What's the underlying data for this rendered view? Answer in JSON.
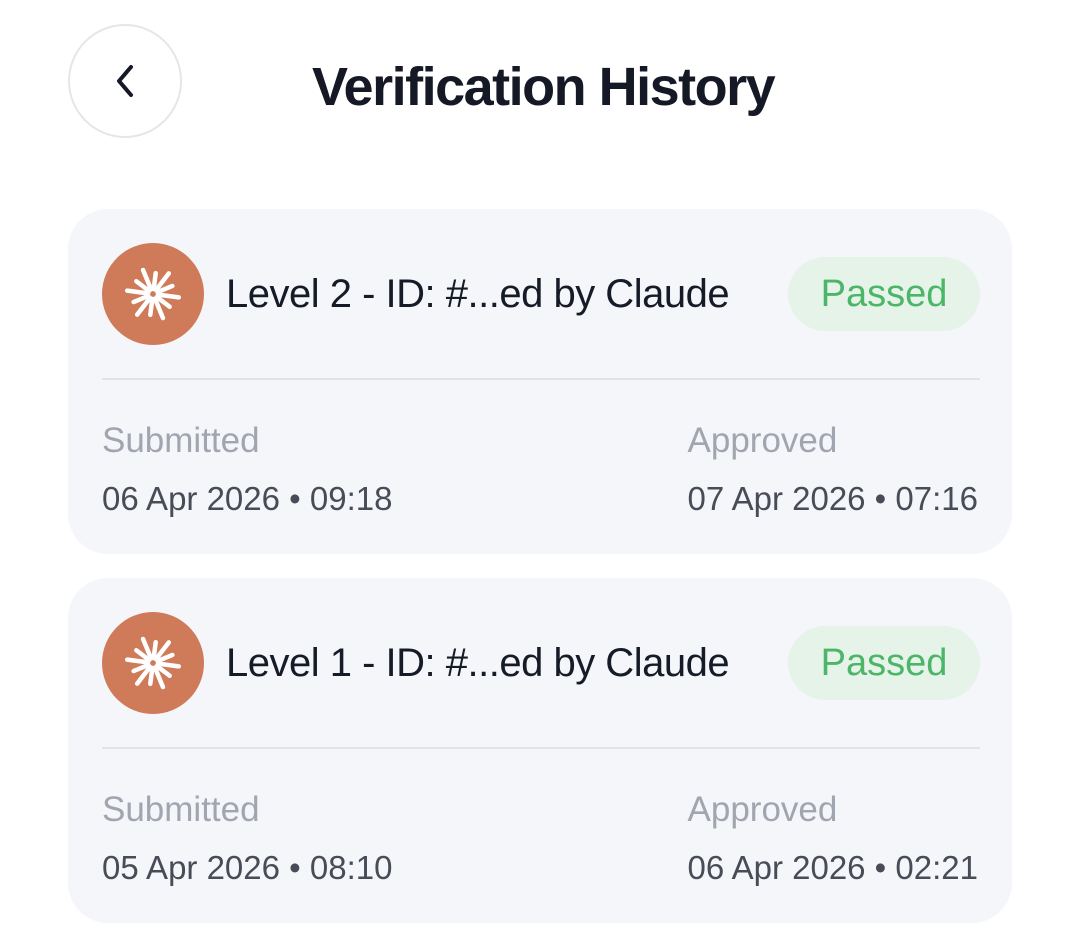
{
  "header": {
    "title": "Verification History",
    "back_icon": "chevron-left-icon"
  },
  "colors": {
    "avatar_bg": "#cf7a58",
    "badge_bg": "#e5f3e8",
    "badge_text": "#4cb668",
    "card_bg": "#f5f6fa"
  },
  "history": [
    {
      "title": "Level 2 - ID: #...ed by Claude",
      "status": "Passed",
      "avatar_icon": "sunburst-logo-icon",
      "submitted_label": "Submitted",
      "submitted_value": "06 Apr 2026 • 09:18",
      "approved_label": "Approved",
      "approved_value": "07 Apr 2026 • 07:16"
    },
    {
      "title": "Level 1 - ID: #...ed by Claude",
      "status": "Passed",
      "avatar_icon": "sunburst-logo-icon",
      "submitted_label": "Submitted",
      "submitted_value": "05 Apr 2026 • 08:10",
      "approved_label": "Approved",
      "approved_value": "06 Apr 2026 • 02:21"
    }
  ]
}
